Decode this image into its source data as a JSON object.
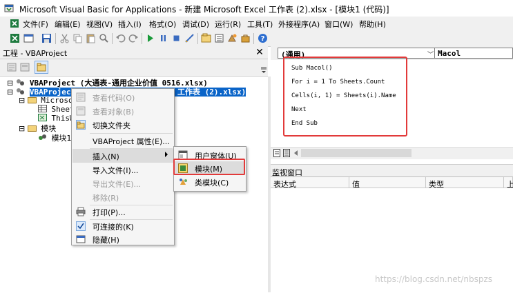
{
  "window": {
    "title": "Microsoft Visual Basic for Applications - 新建 Microsoft Excel 工作表 (2).xlsx - [模块1 (代码)]"
  },
  "menu": [
    "文件(F)",
    "编辑(E)",
    "视图(V)",
    "插入(I)",
    "格式(O)",
    "调试(D)",
    "运行(R)",
    "工具(T)",
    "外接程序(A)",
    "窗口(W)",
    "帮助(H)"
  ],
  "project": {
    "title": "工程 - VBAProject",
    "close_glyph": "✕",
    "tree": {
      "vba1": "VBAProject (大通表-通用企业价值 0516.xlsx)",
      "vba2": "VBAProject (新建 Microsoft Excel 工作表 (2).xlsx)",
      "microsoft": "Microsoft",
      "sheet1": "Sheet1",
      "thisworkbook": "ThisWo",
      "modules": "模块",
      "module1": "模块1"
    }
  },
  "context_menu": {
    "view_code": "查看代码(O)",
    "view_object": "查看对象(B)",
    "toggle_folders": "切换文件夹",
    "properties": "VBAProject 属性(E)...",
    "insert": "插入(N)",
    "import": "导入文件(I)...",
    "export": "导出文件(E)...",
    "remove": "移除(R)",
    "print": "打印(P)...",
    "dockable": "可连接的(K)",
    "hide": "隐藏(H)"
  },
  "submenu": {
    "userform": "用户窗体(U)",
    "module": "模块(M)",
    "class_module": "类模块(C)"
  },
  "code": {
    "object_combo": "(通用)",
    "proc_combo": "Macol",
    "lines": [
      "Sub Macol()",
      "For i = 1 To Sheets.Count",
      "Cells(i, 1) = Sheets(i).Name",
      "Next",
      "End Sub"
    ]
  },
  "watch": {
    "title": "监视窗口",
    "columns": [
      "表达式",
      "值",
      "类型",
      "上"
    ]
  },
  "watermark": "https://blog.csdn.net/nbspzs",
  "colors": {
    "selection": "#0a64c8",
    "highlight_border": "#e23a3a"
  }
}
